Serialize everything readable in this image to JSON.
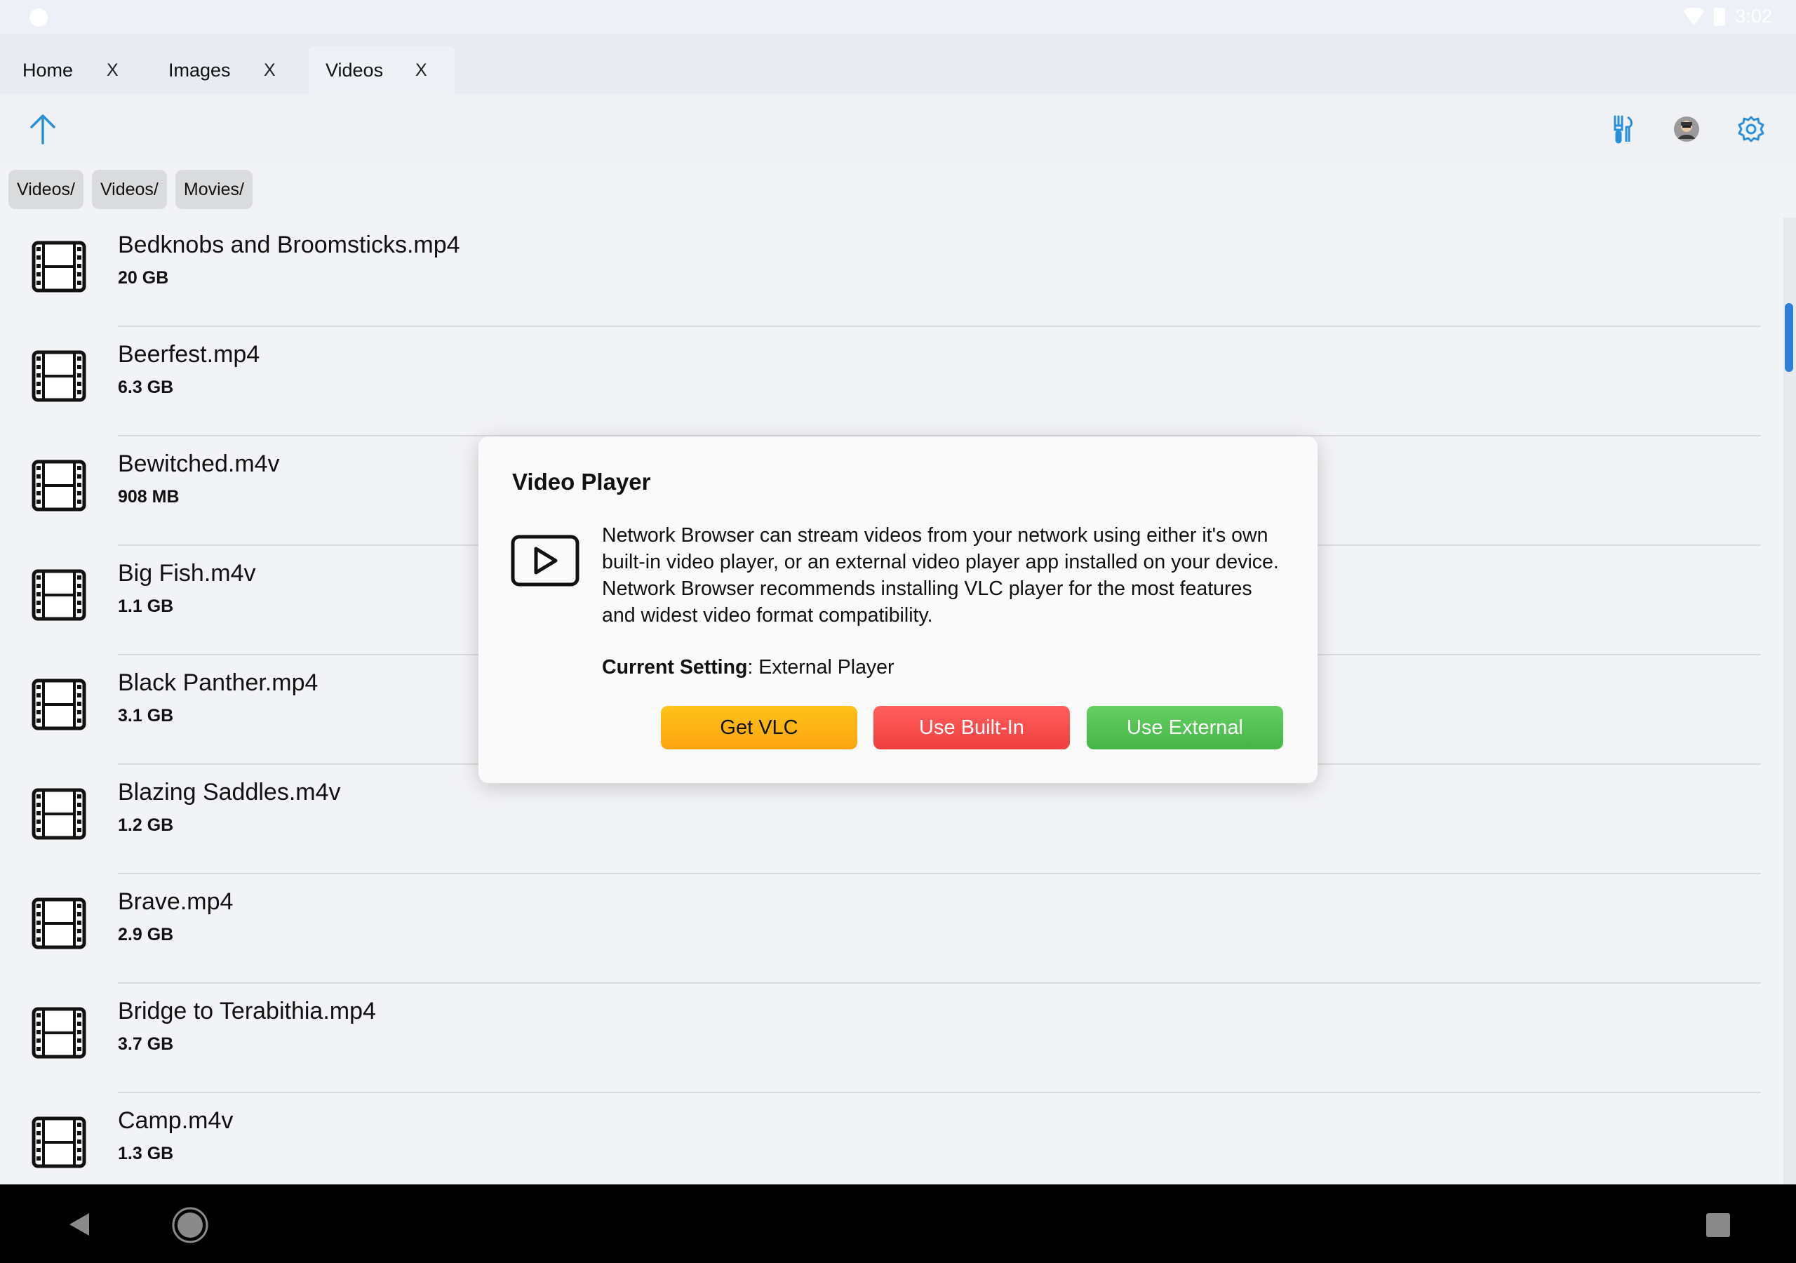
{
  "status_bar": {
    "time": "3:02"
  },
  "tabs": [
    {
      "label": "Home",
      "close": "X"
    },
    {
      "label": "Images",
      "close": "X"
    },
    {
      "label": "Videos",
      "close": "X"
    }
  ],
  "toolbar": {
    "up_icon": "arrow-up-icon",
    "tools_icon": "tools-icon",
    "avatar_icon": "avatar-icon",
    "settings_icon": "gear-icon",
    "accent": "#2a8fdb"
  },
  "breadcrumb": [
    "Videos/",
    "Videos/",
    "Movies/"
  ],
  "files": [
    {
      "name": "Bedknobs and Broomsticks.mp4",
      "size": "20 GB"
    },
    {
      "name": "Beerfest.mp4",
      "size": "6.3 GB"
    },
    {
      "name": "Bewitched.m4v",
      "size": "908 MB"
    },
    {
      "name": "Big Fish.m4v",
      "size": "1.1 GB"
    },
    {
      "name": "Black Panther.mp4",
      "size": "3.1 GB"
    },
    {
      "name": "Blazing Saddles.m4v",
      "size": "1.2 GB"
    },
    {
      "name": "Brave.mp4",
      "size": "2.9 GB"
    },
    {
      "name": "Bridge to Terabithia.mp4",
      "size": "3.7 GB"
    },
    {
      "name": "Camp.m4v",
      "size": "1.3 GB"
    }
  ],
  "dialog": {
    "title": "Video Player",
    "icon": "play-icon",
    "body": "Network Browser can stream videos from your network using either it's own built-in video player, or an external video player app installed on your device. Network Browser recommends installing VLC player for the most features and widest video format compatibility.",
    "setting_label": "Current Setting",
    "setting_value": ": External Player",
    "buttons": {
      "get_vlc": "Get VLC",
      "use_builtin": "Use Built-In",
      "use_external": "Use External"
    },
    "colors": {
      "vlc": "#fdb013",
      "builtin": "#f74c4b",
      "external": "#55c255"
    }
  }
}
